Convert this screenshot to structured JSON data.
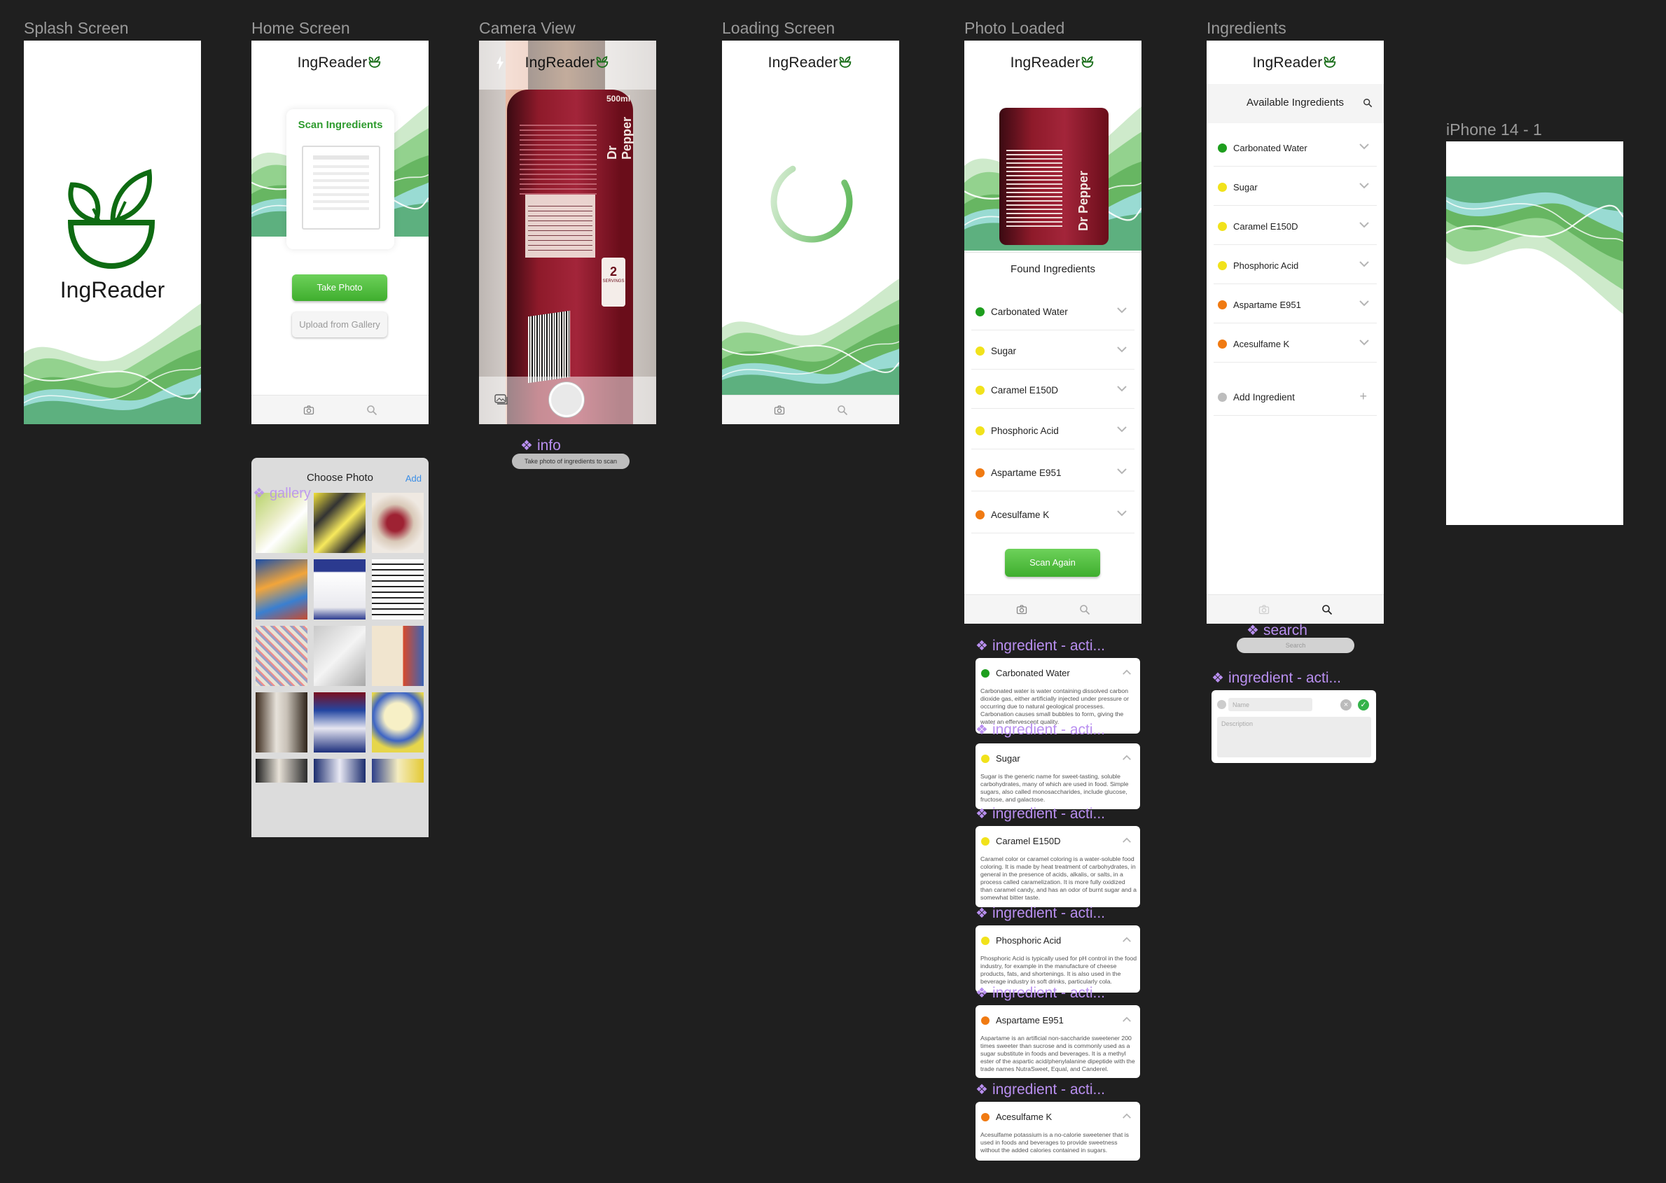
{
  "frames": {
    "splash": {
      "label": "Splash Screen",
      "brand": "IngReader"
    },
    "home": {
      "label": "Home Screen",
      "logo": "IngReader",
      "scan_title": "Scan Ingredients",
      "take_photo": "Take Photo",
      "upload": "Upload from Gallery"
    },
    "camera": {
      "label": "Camera View",
      "logo": "IngReader"
    },
    "loading": {
      "label": "Loading Screen",
      "logo": "IngReader"
    },
    "photo_loaded": {
      "label": "Photo Loaded",
      "logo": "IngReader",
      "found_title": "Found Ingredients",
      "scan_again": "Scan Again",
      "ingredients": [
        {
          "name": "Carbonated Water",
          "color": "#1e9e1e"
        },
        {
          "name": "Sugar",
          "color": "#f1e21b"
        },
        {
          "name": "Caramel E150D",
          "color": "#f1e21b"
        },
        {
          "name": "Phosphoric Acid",
          "color": "#f1e21b"
        },
        {
          "name": "Aspartame E951",
          "color": "#f07a12"
        },
        {
          "name": "Acesulfame K",
          "color": "#f07a12"
        }
      ]
    },
    "ingredients": {
      "label": "Ingredients",
      "logo": "IngReader",
      "header": "Available Ingredients",
      "add_label": "Add Ingredient",
      "items": [
        {
          "name": "Carbonated Water",
          "color": "#1e9e1e"
        },
        {
          "name": "Sugar",
          "color": "#f1e21b"
        },
        {
          "name": "Caramel E150D",
          "color": "#f1e21b"
        },
        {
          "name": "Phosphoric Acid",
          "color": "#f1e21b"
        },
        {
          "name": "Aspartame E951",
          "color": "#f07a12"
        },
        {
          "name": "Acesulfame K",
          "color": "#f07a12"
        }
      ]
    },
    "iphone": {
      "label": "iPhone 14 - 1"
    }
  },
  "gallery": {
    "title": "Choose Photo",
    "add": "Add",
    "component_label": "gallery"
  },
  "info": {
    "component_label": "info",
    "tooltip": "Take photo of ingredients to scan"
  },
  "search": {
    "component_label": "search",
    "placeholder": "Search"
  },
  "bottle_text": {
    "brand": "Dr Pepper",
    "volume": "500ml",
    "servings": "2",
    "servings_label": "SERVINGS"
  },
  "ingredient_cards": [
    {
      "label": "ingredient - acti...",
      "name": "Carbonated Water",
      "color": "#1e9e1e",
      "desc": "Carbonated water is water containing dissolved carbon dioxide gas, either artificially injected under pressure or occurring due to natural geological processes. Carbonation causes small bubbles to form, giving the water an effervescent quality."
    },
    {
      "label": "ingredient - acti...",
      "name": "Sugar",
      "color": "#f1e21b",
      "desc": "Sugar is the generic name for sweet-tasting, soluble carbohydrates, many of which are used in food. Simple sugars, also called monosaccharides, include glucose, fructose, and galactose."
    },
    {
      "label": "ingredient - acti...",
      "name": "Caramel E150D",
      "color": "#f1e21b",
      "desc": "Caramel color or caramel coloring is a water-soluble food coloring. It is made by heat treatment of carbohydrates, in general in the presence of acids, alkalis, or salts, in a process called caramelization. It is more fully oxidized than caramel candy, and has an odor of burnt sugar and a somewhat bitter taste."
    },
    {
      "label": "ingredient - acti...",
      "name": "Phosphoric Acid",
      "color": "#f1e21b",
      "desc": "Phosphoric Acid is typically used for pH control in the food industry, for example in the manufacture of cheese products, fats, and shortenings. It is also used in the beverage industry in soft drinks, particularly cola."
    },
    {
      "label": "ingredient - acti...",
      "name": "Aspartame E951",
      "color": "#f07a12",
      "desc": "Aspartame is an artificial non-saccharide sweetener 200 times sweeter than sucrose and is commonly used as a sugar substitute in foods and beverages. It is a methyl ester of the aspartic acid/phenylalanine dipeptide with the trade names NutraSweet, Equal, and Canderel."
    },
    {
      "label": "ingredient - acti...",
      "name": "Acesulfame K",
      "color": "#f07a12",
      "desc": "Acesulfame potassium is a no-calorie sweetener that is used in foods and beverages to provide sweetness without the added calories contained in sugars."
    }
  ],
  "add_ingredient_form": {
    "label": "ingredient - acti...",
    "name_placeholder": "Name",
    "desc_placeholder": "Description"
  }
}
